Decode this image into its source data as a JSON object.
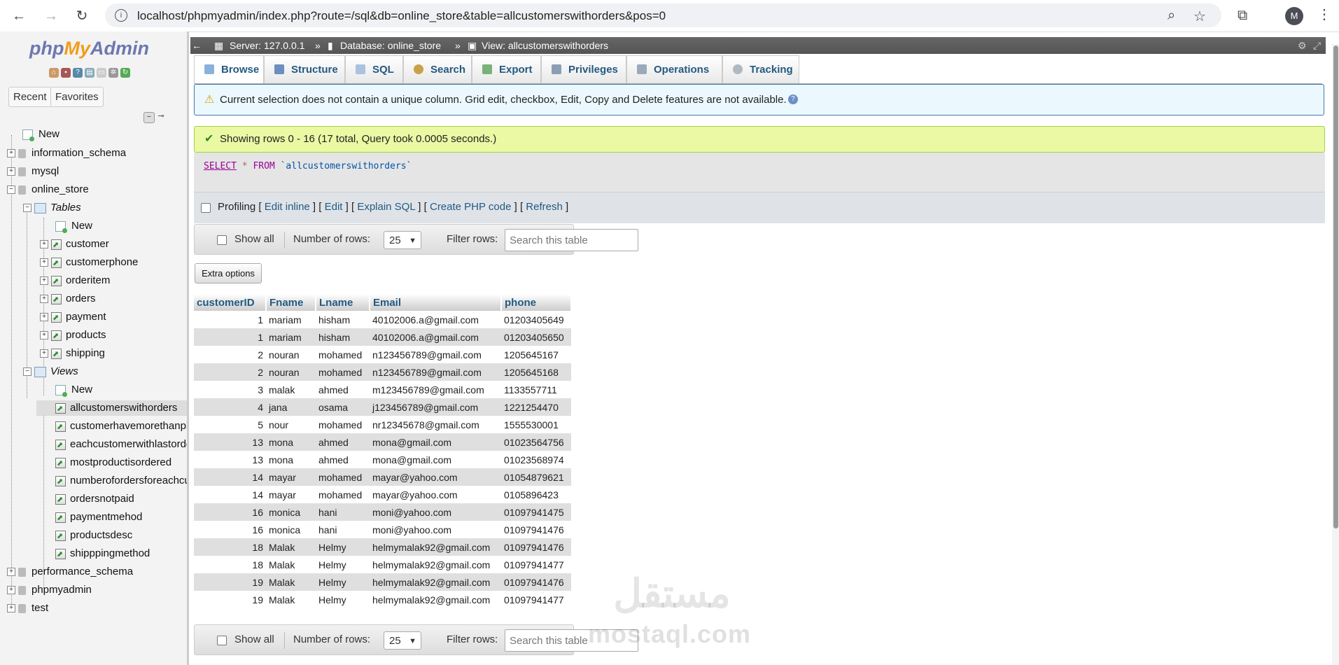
{
  "browser": {
    "url": "localhost/phpmyadmin/index.php?route=/sql&db=online_store&table=allcustomerswithorders&pos=0",
    "profile_initial": "M"
  },
  "nav": {
    "logo_php": "php",
    "logo_my": "My",
    "logo_admin": "Admin",
    "recent": "Recent",
    "favorites": "Favorites",
    "tree": {
      "new": "New",
      "databases": [
        "information_schema",
        "mysql",
        "online_store",
        "performance_schema",
        "phpmyadmin",
        "test"
      ],
      "tables_label": "Tables",
      "tables_new": "New",
      "tables": [
        "customer",
        "customerphone",
        "orderitem",
        "orders",
        "payment",
        "products",
        "shipping"
      ],
      "views_label": "Views",
      "views_new": "New",
      "views": [
        "allcustomerswithorders",
        "customerhavemorethanph",
        "eachcustomerwithlastorde",
        "mostproductisordered",
        "numberofordersforeachcu",
        "ordersnotpaid",
        "paymentmehod",
        "productsdesc",
        "shipppingmethod"
      ]
    }
  },
  "breadcrumb": {
    "server": "Server: 127.0.0.1",
    "database": "Database: online_store",
    "view": "View: allcustomerswithorders",
    "sep": "»"
  },
  "tabs": [
    "Browse",
    "Structure",
    "SQL",
    "Search",
    "Export",
    "Privileges",
    "Operations",
    "Tracking"
  ],
  "notice": "Current selection does not contain a unique column. Grid edit, checkbox, Edit, Copy and Delete features are not available.",
  "success": "Showing rows 0 - 16 (17 total, Query took 0.0005 seconds.)",
  "sql": {
    "keyword": "SELECT",
    "star": "*",
    "from": "FROM",
    "table": "`allcustomerswithorders`"
  },
  "query_links": {
    "profiling": "Profiling",
    "edit_inline": "Edit inline",
    "edit": "Edit",
    "explain": "Explain SQL",
    "php": "Create PHP code",
    "refresh": "Refresh"
  },
  "controls": {
    "show_all": "Show all",
    "num_rows_label": "Number of rows:",
    "num_rows_value": "25",
    "filter_label": "Filter rows:",
    "filter_placeholder": "Search this table"
  },
  "extra_options": "Extra options",
  "table": {
    "columns": [
      "customerID",
      "Fname",
      "Lname",
      "Email",
      "phone"
    ],
    "rows": [
      [
        "1",
        "mariam",
        "hisham",
        "40102006.a@gmail.com",
        "01203405649"
      ],
      [
        "1",
        "mariam",
        "hisham",
        "40102006.a@gmail.com",
        "01203405650"
      ],
      [
        "2",
        "nouran",
        "mohamed",
        "n123456789@gmail.com",
        "1205645167"
      ],
      [
        "2",
        "nouran",
        "mohamed",
        "n123456789@gmail.com",
        "1205645168"
      ],
      [
        "3",
        "malak",
        "ahmed",
        "m123456789@gmail.com",
        "1133557711"
      ],
      [
        "4",
        "jana",
        "osama",
        "j123456789@gmail.com",
        "1221254470"
      ],
      [
        "5",
        "nour",
        "mohamed",
        "nr12345678@gmail.com",
        "1555530001"
      ],
      [
        "13",
        "mona",
        "ahmed",
        "mona@gmail.com",
        "01023564756"
      ],
      [
        "13",
        "mona",
        "ahmed",
        "mona@gmail.com",
        "01023568974"
      ],
      [
        "14",
        "mayar",
        "mohamed",
        "mayar@yahoo.com",
        "01054879621"
      ],
      [
        "14",
        "mayar",
        "mohamed",
        "mayar@yahoo.com",
        "0105896423"
      ],
      [
        "16",
        "monica",
        "hani",
        "moni@yahoo.com",
        "01097941475"
      ],
      [
        "16",
        "monica",
        "hani",
        "moni@yahoo.com",
        "01097941476"
      ],
      [
        "18",
        "Malak",
        "Helmy",
        "helmymalak92@gmail.com",
        "01097941476"
      ],
      [
        "18",
        "Malak",
        "Helmy",
        "helmymalak92@gmail.com",
        "01097941477"
      ],
      [
        "19",
        "Malak",
        "Helmy",
        "helmymalak92@gmail.com",
        "01097941476"
      ],
      [
        "19",
        "Malak",
        "Helmy",
        "helmymalak92@gmail.com",
        "01097941477"
      ]
    ]
  },
  "watermark": {
    "latin": "mostaql.com",
    "arabic": "مستقل"
  }
}
